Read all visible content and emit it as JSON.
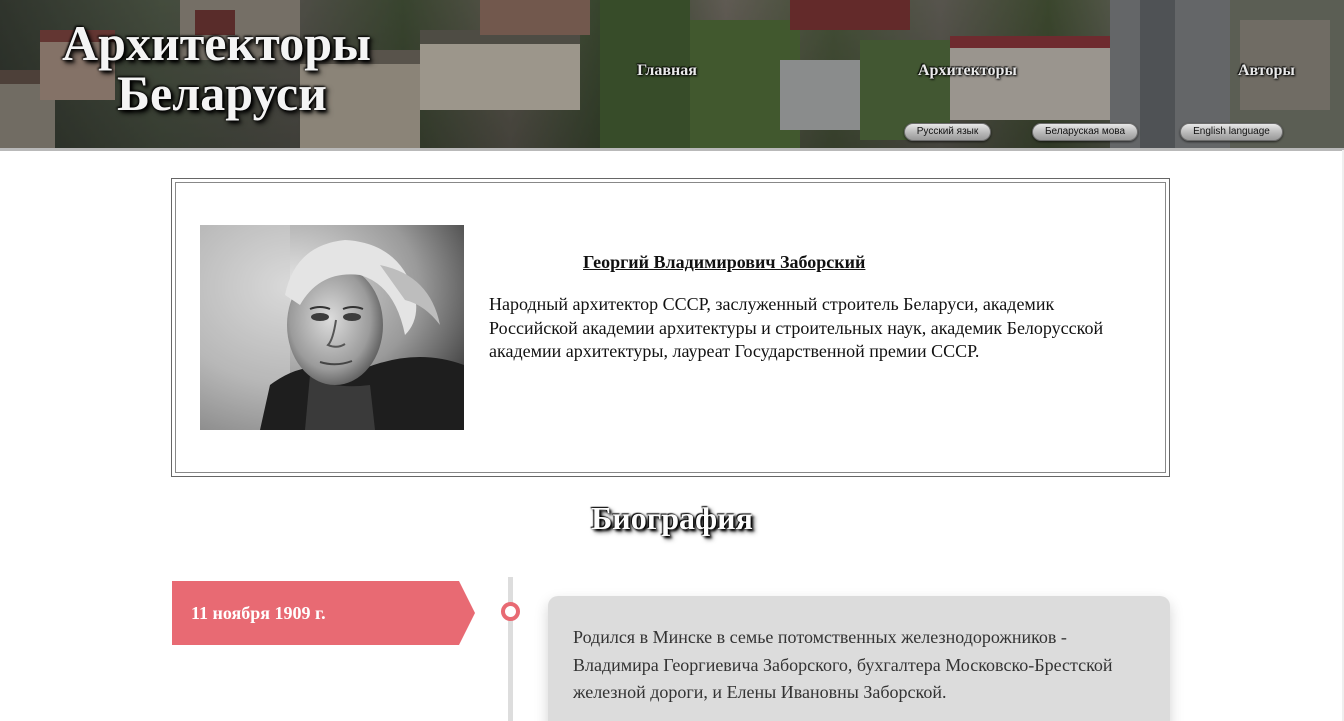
{
  "site": {
    "logo_line1": "Архитекторы",
    "logo_line2": "Беларуси"
  },
  "nav": {
    "home": "Главная",
    "architects": "Архитекторы",
    "authors": "Авторы"
  },
  "languages": {
    "ru": "Русский язык",
    "by": "Беларуская мова",
    "en": "English language"
  },
  "person": {
    "name": "Георгий Владимирович Заборский",
    "description": "Народный архитектор СССР, заслуженный строитель Беларуси, академик Российской академии архитектуры и строительных наук, академик Белорусской академии архитектуры, лауреат Государственной премии СССР."
  },
  "biography": {
    "heading": "Биография",
    "events": [
      {
        "date": "11 ноября 1909 г.",
        "text": "Родился в Минске в семье потомственных железнодорожников - Владимира Георгиевича Заборского, бухгалтера Московско-Брестской железной дороги, и Елены Ивановны Заборской."
      }
    ]
  },
  "colors": {
    "accent": "#e86a73",
    "event_card": "#dcdcdc",
    "timeline": "#dddddd"
  }
}
